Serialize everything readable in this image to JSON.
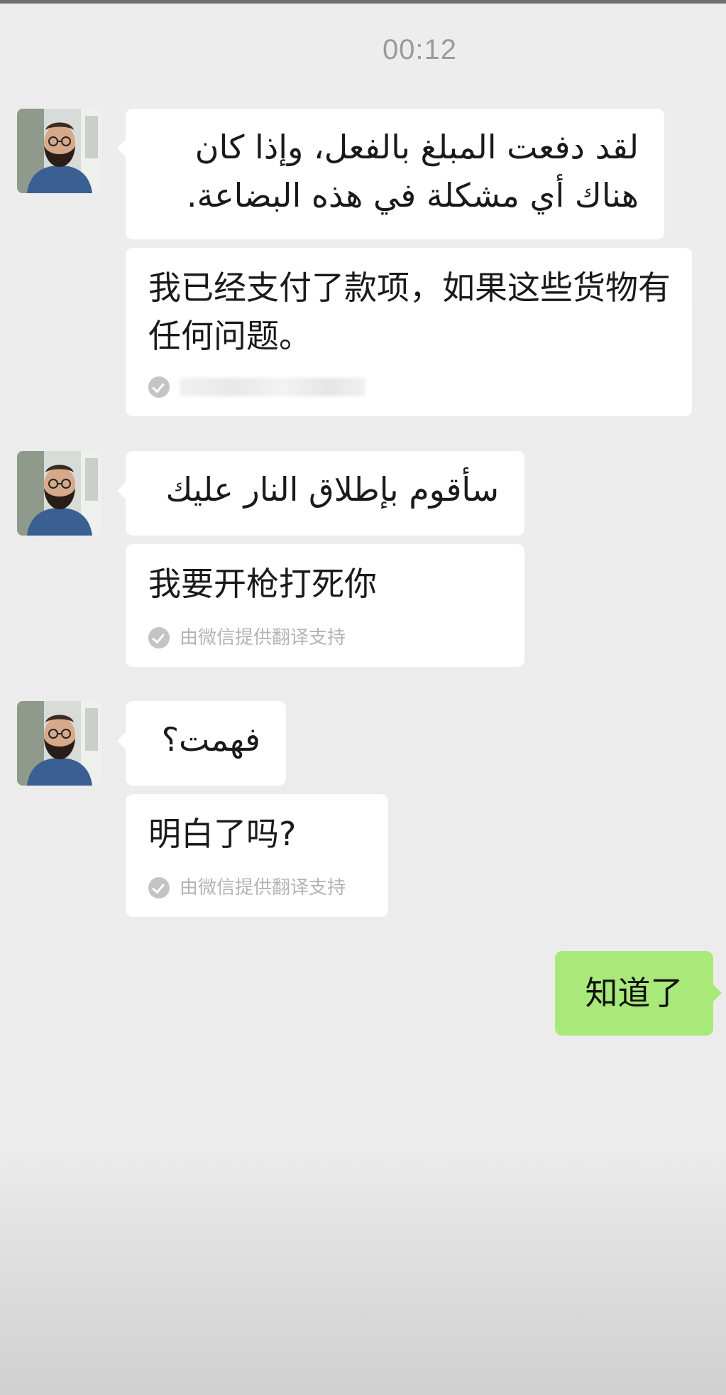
{
  "header": {
    "timestamp": "00:12"
  },
  "messages": [
    {
      "sender": "contact",
      "avatar_icon": "contact-avatar-photo",
      "original": "لقد دفعت المبلغ بالفعل، وإذا كان هناك أي مشكلة في هذه البضاعة.",
      "translation": "我已经支付了款项，如果这些货物有任何问题。",
      "translation_note": ""
    },
    {
      "sender": "contact",
      "avatar_icon": "contact-avatar-photo",
      "original": "سأقوم بإطلاق النار عليك",
      "translation": "我要开枪打死你",
      "translation_note": "由微信提供翻译支持"
    },
    {
      "sender": "contact",
      "avatar_icon": "contact-avatar-photo",
      "original": "فهمت؟",
      "translation": "明白了吗?",
      "translation_note": "由微信提供翻译支持"
    },
    {
      "sender": "self",
      "text": "知道了"
    }
  ],
  "colors": {
    "background": "#ededed",
    "incoming_bubble": "#ffffff",
    "outgoing_bubble": "#a9e97a",
    "timestamp": "#9b9b9b",
    "translation_note": "#b4b4b4"
  }
}
